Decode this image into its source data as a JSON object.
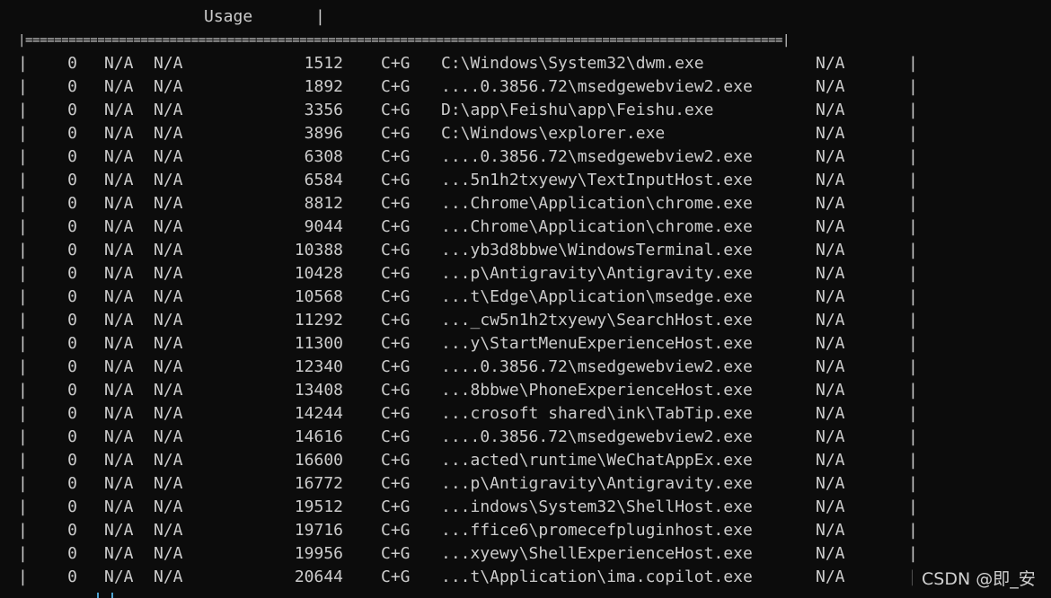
{
  "header": {
    "usage_label": "Usage",
    "pipe": "|"
  },
  "separator": "|=========================================================================================================|",
  "rows": [
    {
      "gpu": "0",
      "gi": "N/A",
      "ci": "N/A",
      "pid": "1512",
      "type": "C+G",
      "name": "C:\\Windows\\System32\\dwm.exe",
      "mem": "N/A"
    },
    {
      "gpu": "0",
      "gi": "N/A",
      "ci": "N/A",
      "pid": "1892",
      "type": "C+G",
      "name": "....0.3856.72\\msedgewebview2.exe",
      "mem": "N/A"
    },
    {
      "gpu": "0",
      "gi": "N/A",
      "ci": "N/A",
      "pid": "3356",
      "type": "C+G",
      "name": "D:\\app\\Feishu\\app\\Feishu.exe",
      "mem": "N/A"
    },
    {
      "gpu": "0",
      "gi": "N/A",
      "ci": "N/A",
      "pid": "3896",
      "type": "C+G",
      "name": "C:\\Windows\\explorer.exe",
      "mem": "N/A"
    },
    {
      "gpu": "0",
      "gi": "N/A",
      "ci": "N/A",
      "pid": "6308",
      "type": "C+G",
      "name": "....0.3856.72\\msedgewebview2.exe",
      "mem": "N/A"
    },
    {
      "gpu": "0",
      "gi": "N/A",
      "ci": "N/A",
      "pid": "6584",
      "type": "C+G",
      "name": "...5n1h2txyewy\\TextInputHost.exe",
      "mem": "N/A"
    },
    {
      "gpu": "0",
      "gi": "N/A",
      "ci": "N/A",
      "pid": "8812",
      "type": "C+G",
      "name": "...Chrome\\Application\\chrome.exe",
      "mem": "N/A"
    },
    {
      "gpu": "0",
      "gi": "N/A",
      "ci": "N/A",
      "pid": "9044",
      "type": "C+G",
      "name": "...Chrome\\Application\\chrome.exe",
      "mem": "N/A"
    },
    {
      "gpu": "0",
      "gi": "N/A",
      "ci": "N/A",
      "pid": "10388",
      "type": "C+G",
      "name": "...yb3d8bbwe\\WindowsTerminal.exe",
      "mem": "N/A"
    },
    {
      "gpu": "0",
      "gi": "N/A",
      "ci": "N/A",
      "pid": "10428",
      "type": "C+G",
      "name": "...p\\Antigravity\\Antigravity.exe",
      "mem": "N/A"
    },
    {
      "gpu": "0",
      "gi": "N/A",
      "ci": "N/A",
      "pid": "10568",
      "type": "C+G",
      "name": "...t\\Edge\\Application\\msedge.exe",
      "mem": "N/A"
    },
    {
      "gpu": "0",
      "gi": "N/A",
      "ci": "N/A",
      "pid": "11292",
      "type": "C+G",
      "name": "..._cw5n1h2txyewy\\SearchHost.exe",
      "mem": "N/A"
    },
    {
      "gpu": "0",
      "gi": "N/A",
      "ci": "N/A",
      "pid": "11300",
      "type": "C+G",
      "name": "...y\\StartMenuExperienceHost.exe",
      "mem": "N/A"
    },
    {
      "gpu": "0",
      "gi": "N/A",
      "ci": "N/A",
      "pid": "12340",
      "type": "C+G",
      "name": "....0.3856.72\\msedgewebview2.exe",
      "mem": "N/A"
    },
    {
      "gpu": "0",
      "gi": "N/A",
      "ci": "N/A",
      "pid": "13408",
      "type": "C+G",
      "name": "...8bbwe\\PhoneExperienceHost.exe",
      "mem": "N/A"
    },
    {
      "gpu": "0",
      "gi": "N/A",
      "ci": "N/A",
      "pid": "14244",
      "type": "C+G",
      "name": "...crosoft shared\\ink\\TabTip.exe",
      "mem": "N/A"
    },
    {
      "gpu": "0",
      "gi": "N/A",
      "ci": "N/A",
      "pid": "14616",
      "type": "C+G",
      "name": "....0.3856.72\\msedgewebview2.exe",
      "mem": "N/A"
    },
    {
      "gpu": "0",
      "gi": "N/A",
      "ci": "N/A",
      "pid": "16600",
      "type": "C+G",
      "name": "...acted\\runtime\\WeChatAppEx.exe",
      "mem": "N/A"
    },
    {
      "gpu": "0",
      "gi": "N/A",
      "ci": "N/A",
      "pid": "16772",
      "type": "C+G",
      "name": "...p\\Antigravity\\Antigravity.exe",
      "mem": "N/A"
    },
    {
      "gpu": "0",
      "gi": "N/A",
      "ci": "N/A",
      "pid": "19512",
      "type": "C+G",
      "name": "...indows\\System32\\ShellHost.exe",
      "mem": "N/A"
    },
    {
      "gpu": "0",
      "gi": "N/A",
      "ci": "N/A",
      "pid": "19716",
      "type": "C+G",
      "name": "...ffice6\\promecefpluginhost.exe",
      "mem": "N/A"
    },
    {
      "gpu": "0",
      "gi": "N/A",
      "ci": "N/A",
      "pid": "19956",
      "type": "C+G",
      "name": "...xyewy\\ShellExperienceHost.exe",
      "mem": "N/A"
    },
    {
      "gpu": "0",
      "gi": "N/A",
      "ci": "N/A",
      "pid": "20644",
      "type": "C+G",
      "name": "...t\\Application\\ima.copilot.exe",
      "mem": "N/A"
    }
  ],
  "watermark": "CSDN @即_安",
  "colors": {
    "background": "#0c0c0c",
    "text": "#cccccc",
    "cursor_accent": "#4fa3d1"
  }
}
